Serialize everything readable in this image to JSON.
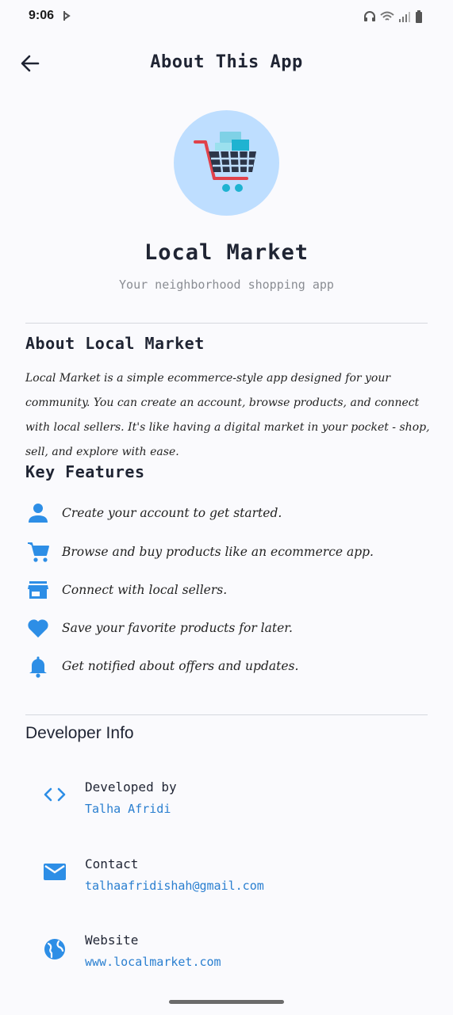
{
  "status_bar": {
    "time": "9:06"
  },
  "app_bar": {
    "title": "About This App"
  },
  "header": {
    "app_name": "Local Market",
    "tagline": "Your neighborhood shopping app"
  },
  "about": {
    "title": "About Local Market",
    "body": "Local Market is a simple ecommerce-style app designed for your community. You can create an account, browse products, and connect with local sellers. It's like having a digital market in your pocket - shop, sell, and explore with ease."
  },
  "features": {
    "title": "Key Features",
    "items": [
      {
        "icon": "person-icon",
        "label": "Create your account to get started."
      },
      {
        "icon": "shopping-cart-icon",
        "label": "Browse and buy products like an ecommerce app."
      },
      {
        "icon": "store-icon",
        "label": "Connect with local sellers."
      },
      {
        "icon": "heart-icon",
        "label": "Save your favorite products for later."
      },
      {
        "icon": "bell-icon",
        "label": "Get notified about offers and updates."
      }
    ]
  },
  "developer": {
    "title": "Developer Info",
    "items": [
      {
        "icon": "code-icon",
        "label": "Developed by",
        "value": "Talha Afridi"
      },
      {
        "icon": "email-icon",
        "label": "Contact",
        "value": "talhaafridishah@gmail.com"
      },
      {
        "icon": "globe-icon",
        "label": "Website",
        "value": "www.localmarket.com"
      }
    ]
  },
  "colors": {
    "accent": "#2a7fd0",
    "icon_blue": "#2d8ee6",
    "logo_bg": "#bedeff",
    "background": "#fafafd"
  }
}
